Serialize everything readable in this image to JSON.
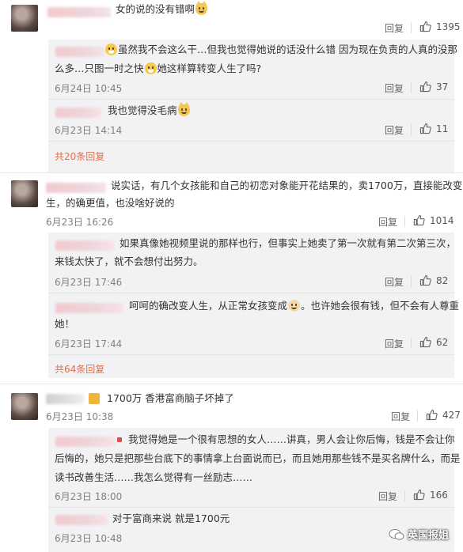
{
  "comments": [
    {
      "text": "女的说的没有错啊",
      "reply": "回复",
      "likes": "1395",
      "subs": [
        {
          "line1": "虽然我不会这么干…但我也觉得她说的话没什么错 因为现在负责的人真的没那",
          "line2a": "么多…只图一时之快",
          "line2b": "她这样算转变人生了吗?",
          "time": "6月24日 10:45",
          "reply": "回复",
          "likes": "37"
        },
        {
          "line1": "我也觉得没毛病",
          "time": "6月23日 14:14",
          "reply": "回复",
          "likes": "11"
        }
      ],
      "more": "共20条回复"
    },
    {
      "line1": "说实话，有几个女孩能和自己的初恋对象能开花结果的，卖1700万，直接能改变人",
      "line2": "生，的确更值，也没啥好说的",
      "time": "6月23日 16:26",
      "reply": "回复",
      "likes": "1014",
      "subs": [
        {
          "line1": "如果真像她视频里说的那样也行，但事实上她卖了第一次就有第二次第三次，",
          "line2": "来钱太快了，就不会想付出努力。",
          "time": "6月23日 17:46",
          "reply": "回复",
          "likes": "82"
        },
        {
          "line1a": "呵呵的确改变人生，从正常女孩变成",
          "line1b": "。也许她会很有钱，但不会有人尊重",
          "line2": "她！",
          "time": "6月23日 17:44",
          "reply": "回复",
          "likes": "62"
        }
      ],
      "more": "共64条回复"
    },
    {
      "line1": "1700万 香港富商脑子坏掉了",
      "time": "6月23日 10:38",
      "reply": "回复",
      "likes": "427",
      "subs": [
        {
          "line1": "我觉得她是一个很有思想的女人……讲真，男人会让你后悔，钱是不会让你",
          "line2": "后悔的，她只是把那些台底下的事情拿上台面说而已，而且她用那些钱不是买名牌什么，而是",
          "line3": "读书改善生活……我怎么觉得有一丝励志……",
          "time": "6月23日 18:00",
          "reply": "回复",
          "likes": "166"
        },
        {
          "line1": "对于富商来说 就是1700元",
          "time": "6月23日 10:48"
        }
      ]
    }
  ],
  "watermark": "英国报姐",
  "colors": {
    "more_link": "#e06f4b",
    "reply_bg": "#f2f2f5"
  },
  "icons": {
    "like": "thumbs-up-icon"
  }
}
